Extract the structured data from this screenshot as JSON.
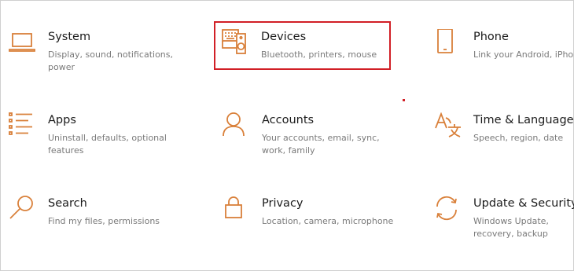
{
  "accent_color": "#d9803a",
  "highlight_color": "#d11f26",
  "tiles": [
    {
      "id": "system",
      "icon": "laptop-icon",
      "title": "System",
      "desc": "Display, sound, notifications, power"
    },
    {
      "id": "devices",
      "icon": "keyboard-speaker-icon",
      "title": "Devices",
      "desc": "Bluetooth, printers, mouse"
    },
    {
      "id": "phone",
      "icon": "phone-icon",
      "title": "Phone",
      "desc": "Link your Android, iPhone"
    },
    {
      "id": "apps",
      "icon": "apps-list-icon",
      "title": "Apps",
      "desc": "Uninstall, defaults, optional features"
    },
    {
      "id": "accounts",
      "icon": "person-icon",
      "title": "Accounts",
      "desc": "Your accounts, email, sync, work, family"
    },
    {
      "id": "time-language",
      "icon": "language-icon",
      "title": "Time & Language",
      "desc": "Speech, region, date"
    },
    {
      "id": "search",
      "icon": "search-icon",
      "title": "Search",
      "desc": "Find my files, permissions"
    },
    {
      "id": "privacy",
      "icon": "lock-icon",
      "title": "Privacy",
      "desc": "Location, camera, microphone"
    },
    {
      "id": "update-security",
      "icon": "sync-icon",
      "title": "Update & Security",
      "desc": "Windows Update, recovery, backup"
    }
  ]
}
